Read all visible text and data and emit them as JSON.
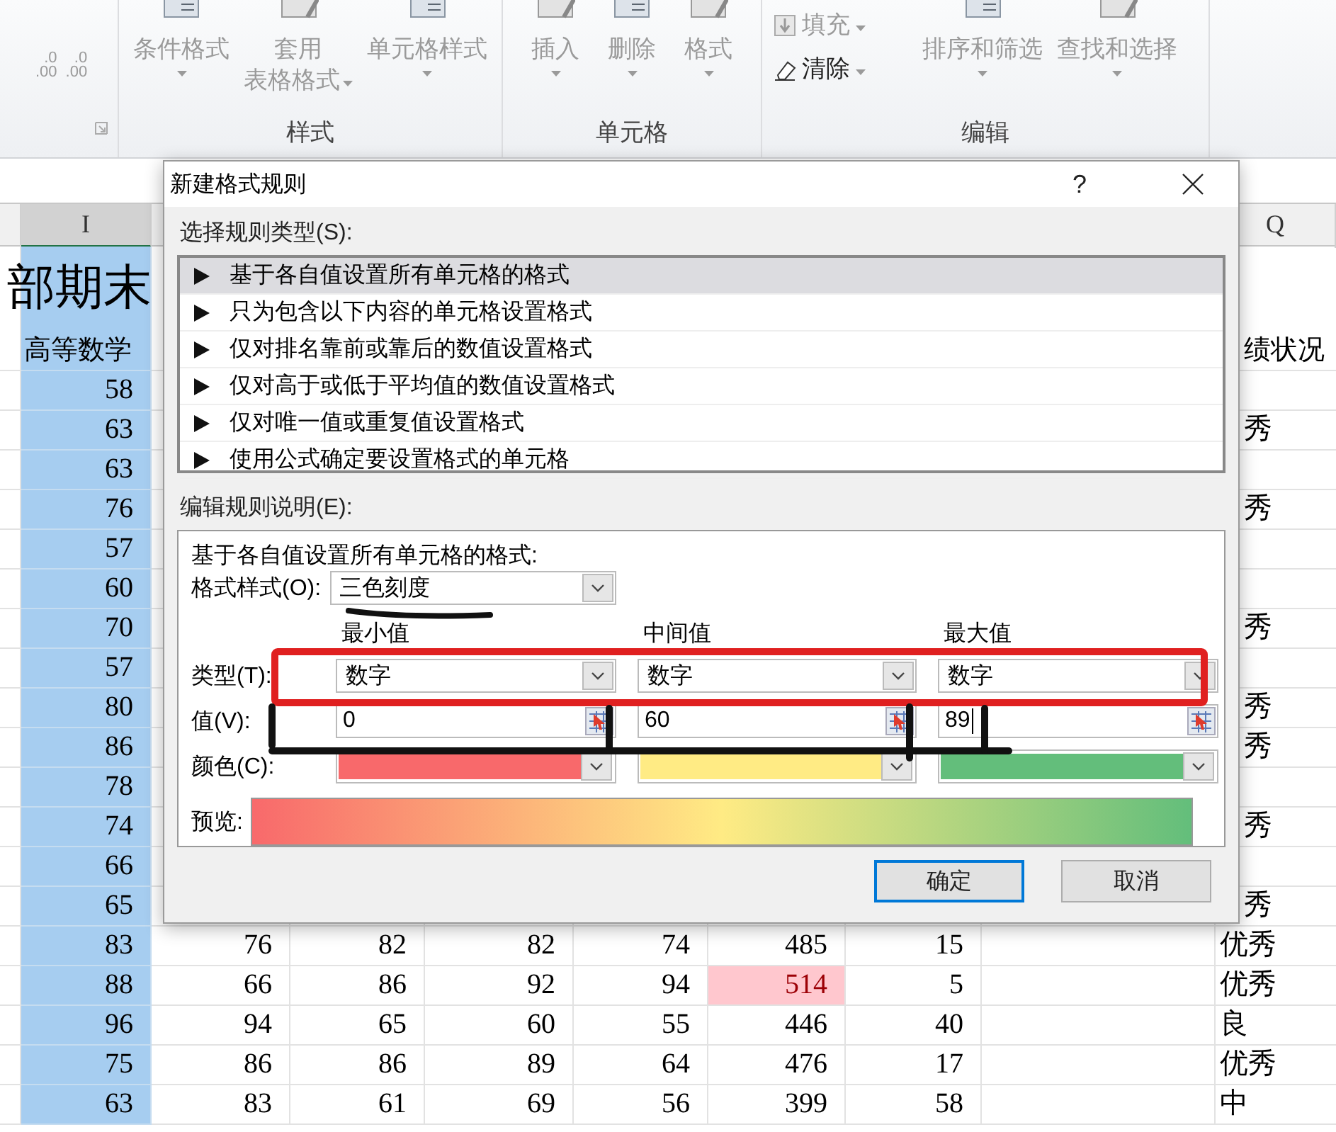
{
  "ribbon": {
    "decimal_buttons": [
      {
        "top": ".0",
        "bottom": ".00",
        "disabled": true
      },
      {
        "top": ".0",
        "bottom": ".00",
        "disabled": true
      }
    ],
    "groups": [
      {
        "label": "样式",
        "buttons": [
          {
            "lines": [
              "条件格式"
            ],
            "disabled": true,
            "kind": "large"
          },
          {
            "lines": [
              "套用",
              "表格格式"
            ],
            "disabled": true,
            "kind": "large"
          },
          {
            "lines": [
              "单元格样式"
            ],
            "disabled": true,
            "kind": "large"
          }
        ]
      },
      {
        "label": "单元格",
        "buttons": [
          {
            "lines": [
              "插入"
            ],
            "disabled": true,
            "kind": "large"
          },
          {
            "lines": [
              "删除"
            ],
            "disabled": true,
            "kind": "large"
          },
          {
            "lines": [
              "格式"
            ],
            "disabled": true,
            "kind": "large"
          }
        ]
      },
      {
        "label": "编辑",
        "buttons": [
          {
            "lines": [
              "填充"
            ],
            "disabled": true,
            "kind": "small"
          },
          {
            "lines": [
              "清除"
            ],
            "disabled": false,
            "kind": "small"
          },
          {
            "lines": [
              "排序和筛选"
            ],
            "disabled": true,
            "kind": "large"
          },
          {
            "lines": [
              "查找和选择"
            ],
            "disabled": true,
            "kind": "large"
          }
        ]
      }
    ]
  },
  "sheet": {
    "column_headers": [
      {
        "label": "I",
        "selected": true
      },
      {
        "label": "Q",
        "selected": false
      }
    ],
    "title": "部期末",
    "header": {
      "column_i": "高等数学",
      "column_q": "绩状况"
    },
    "rows": [
      {
        "cells": [
          {
            "text": "58",
            "highlighted": false
          }
        ]
      },
      {
        "cells": [
          {
            "text": "63",
            "highlighted": false
          }
        ],
        "column_q": "秀"
      },
      {
        "cells": [
          {
            "text": "63",
            "highlighted": false
          }
        ]
      },
      {
        "cells": [
          {
            "text": "76",
            "highlighted": false
          }
        ],
        "column_q": "秀"
      },
      {
        "cells": [
          {
            "text": "57",
            "highlighted": false
          }
        ]
      },
      {
        "cells": [
          {
            "text": "60",
            "highlighted": false
          }
        ]
      },
      {
        "cells": [
          {
            "text": "70",
            "highlighted": false
          }
        ],
        "column_q": "秀"
      },
      {
        "cells": [
          {
            "text": "57",
            "highlighted": false
          }
        ]
      },
      {
        "cells": [
          {
            "text": "80",
            "highlighted": false
          }
        ],
        "column_q": "秀"
      },
      {
        "cells": [
          {
            "text": "86",
            "highlighted": false
          }
        ],
        "column_q": "秀"
      },
      {
        "cells": [
          {
            "text": "78",
            "highlighted": false
          }
        ]
      },
      {
        "cells": [
          {
            "text": "74",
            "highlighted": false
          }
        ],
        "column_q": "秀"
      },
      {
        "cells": [
          {
            "text": "66",
            "highlighted": false
          }
        ]
      },
      {
        "cells": [
          {
            "text": "65",
            "highlighted": false
          }
        ],
        "column_q": "秀"
      },
      {
        "cells": [
          {
            "text": "83",
            "highlighted": false
          },
          {
            "text": "76",
            "highlighted": false
          },
          {
            "text": "82",
            "highlighted": false
          },
          {
            "text": "82",
            "highlighted": false
          },
          {
            "text": "74",
            "highlighted": false
          },
          {
            "text": "485",
            "highlighted": false
          },
          {
            "text": "15",
            "highlighted": false
          }
        ],
        "column_q": "优秀"
      },
      {
        "cells": [
          {
            "text": "88",
            "highlighted": false
          },
          {
            "text": "66",
            "highlighted": false
          },
          {
            "text": "86",
            "highlighted": false
          },
          {
            "text": "92",
            "highlighted": false
          },
          {
            "text": "94",
            "highlighted": false
          },
          {
            "text": "514",
            "highlighted": true
          },
          {
            "text": "5",
            "highlighted": false
          }
        ],
        "column_q": "优秀"
      },
      {
        "cells": [
          {
            "text": "96",
            "highlighted": false
          },
          {
            "text": "94",
            "highlighted": false
          },
          {
            "text": "65",
            "highlighted": false
          },
          {
            "text": "60",
            "highlighted": false
          },
          {
            "text": "55",
            "highlighted": false
          },
          {
            "text": "446",
            "highlighted": false
          },
          {
            "text": "40",
            "highlighted": false
          }
        ],
        "column_q": "良"
      },
      {
        "cells": [
          {
            "text": "75",
            "highlighted": false
          },
          {
            "text": "86",
            "highlighted": false
          },
          {
            "text": "86",
            "highlighted": false
          },
          {
            "text": "89",
            "highlighted": false
          },
          {
            "text": "64",
            "highlighted": false
          },
          {
            "text": "476",
            "highlighted": false
          },
          {
            "text": "17",
            "highlighted": false
          }
        ],
        "column_q": "优秀"
      },
      {
        "cells": [
          {
            "text": "63",
            "highlighted": false
          },
          {
            "text": "83",
            "highlighted": false
          },
          {
            "text": "61",
            "highlighted": false
          },
          {
            "text": "69",
            "highlighted": false
          },
          {
            "text": "56",
            "highlighted": false
          },
          {
            "text": "399",
            "highlighted": false
          },
          {
            "text": "58",
            "highlighted": false
          }
        ],
        "column_q": "中"
      }
    ]
  },
  "dialog": {
    "title": "新建格式规则",
    "help": "?",
    "rule_type_label": "选择规则类型(S):",
    "rule_types": [
      {
        "label": "基于各自值设置所有单元格的格式",
        "selected": true
      },
      {
        "label": "只为包含以下内容的单元格设置格式",
        "selected": false
      },
      {
        "label": "仅对排名靠前或靠后的数值设置格式",
        "selected": false
      },
      {
        "label": "仅对高于或低于平均值的数值设置格式",
        "selected": false
      },
      {
        "label": "仅对唯一值或重复值设置格式",
        "selected": false
      },
      {
        "label": "使用公式确定要设置格式的单元格",
        "selected": false
      }
    ],
    "description_label": "编辑规则说明(E):",
    "description_title": "基于各自值设置所有单元格的格式:",
    "format_style": {
      "label": "格式样式(O):",
      "value": "三色刻度"
    },
    "type_label": "类型(T):",
    "value_label": "值(V):",
    "color_label": "颜色(C):",
    "points": [
      {
        "heading": "最小值",
        "type": "数字",
        "value": "0",
        "color": "#f8696b",
        "focused": false
      },
      {
        "heading": "中间值",
        "type": "数字",
        "value": "60",
        "color": "#ffeb84",
        "focused": false
      },
      {
        "heading": "最大值",
        "type": "数字",
        "value": "89",
        "color": "#63be7b",
        "focused": true
      }
    ],
    "preview_label": "预览:",
    "buttons": [
      {
        "label": "确定",
        "focused": true
      },
      {
        "label": "取消",
        "focused": false
      }
    ]
  }
}
